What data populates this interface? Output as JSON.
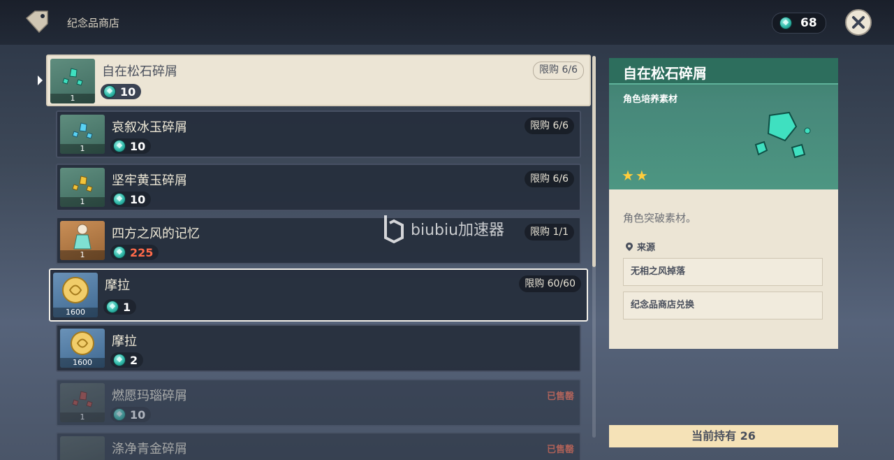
{
  "header": {
    "title": "纪念品商店",
    "currency_amount": "68",
    "currency_icon": "mora-coin-icon"
  },
  "list": {
    "items": [
      {
        "name": "自在松石碎屑",
        "price": "10",
        "limit": "限购 6/6",
        "qty": "1"
      },
      {
        "name": "哀叙冰玉碎屑",
        "price": "10",
        "limit": "限购 6/6",
        "qty": "1"
      },
      {
        "name": "坚牢黄玉碎屑",
        "price": "10",
        "limit": "限购 6/6",
        "qty": "1"
      },
      {
        "name": "四方之风的记忆",
        "price": "225",
        "limit": "限购 1/1",
        "qty": "1"
      },
      {
        "name": "摩拉",
        "price": "1",
        "limit": "限购 60/60",
        "qty": "1600"
      },
      {
        "name": "摩拉",
        "price": "2",
        "limit": "",
        "qty": "1600"
      },
      {
        "name": "燃愿玛瑙碎屑",
        "price": "10",
        "limit": "",
        "status": "已售罄",
        "qty": "1"
      },
      {
        "name": "涤净青金碎屑",
        "price": "",
        "limit": "",
        "status": "已售罄",
        "qty": ""
      }
    ]
  },
  "watermark": {
    "text": "biubiu加速器"
  },
  "detail": {
    "title": "自在松石碎屑",
    "type": "角色培养素材",
    "stars": "★★",
    "description": "角色突破素材。",
    "source_label": "来源",
    "sources": [
      "无相之风掉落",
      "纪念品商店兑换"
    ]
  },
  "footer": {
    "held": "当前持有 26"
  },
  "colors": {
    "accent_green": "#2d6e5d",
    "price_red": "#ff6a4a",
    "star": "#ffcd3c"
  }
}
